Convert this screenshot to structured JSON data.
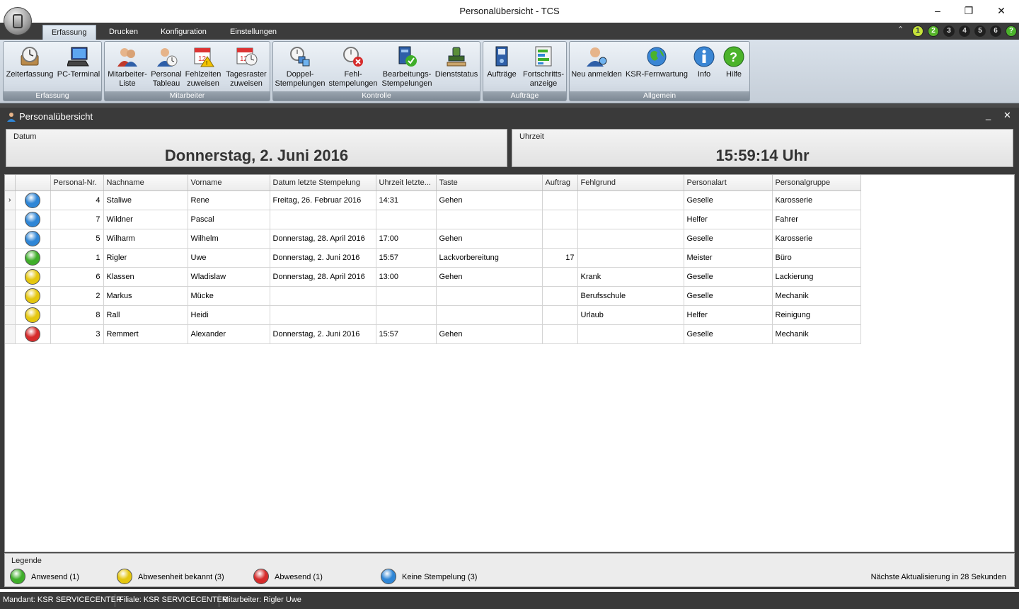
{
  "window": {
    "title": "Personalübersicht - TCS",
    "minimize": "–",
    "maximize": "❐",
    "close": "✕"
  },
  "ribbon_tabs": [
    "Erfassung",
    "Drucken",
    "Konfiguration",
    "Einstellungen"
  ],
  "quick_numbers": [
    "1",
    "2",
    "3",
    "4",
    "5",
    "6",
    "?"
  ],
  "ribbon_groups": [
    {
      "label": "Erfassung",
      "buttons": [
        [
          "Zeiterfassung",
          ""
        ],
        [
          "PC-Terminal",
          ""
        ]
      ]
    },
    {
      "label": "Mitarbeiter",
      "buttons": [
        [
          "Mitarbeiter-",
          "Liste"
        ],
        [
          "Personal",
          "Tableau"
        ],
        [
          "Fehlzeiten",
          "zuweisen"
        ],
        [
          "Tagesraster",
          "zuweisen"
        ]
      ]
    },
    {
      "label": "Kontrolle",
      "buttons": [
        [
          "Doppel-",
          "Stempelungen"
        ],
        [
          "Fehl-",
          "stempelungen"
        ],
        [
          "Bearbeitungs-",
          "Stempelungen"
        ],
        [
          "Dienststatus",
          ""
        ]
      ]
    },
    {
      "label": "Aufträge",
      "buttons": [
        [
          "Aufträge",
          ""
        ],
        [
          "Fortschritts-",
          "anzeige"
        ]
      ]
    },
    {
      "label": "Allgemein",
      "buttons": [
        [
          "Neu anmelden",
          ""
        ],
        [
          "KSR-Fernwartung",
          ""
        ],
        [
          "Info",
          ""
        ],
        [
          "Hilfe",
          ""
        ]
      ]
    }
  ],
  "panel": {
    "title": "Personalübersicht",
    "minimize": "_",
    "close": "✕"
  },
  "datum": {
    "label": "Datum",
    "value": "Donnerstag, 2. Juni 2016"
  },
  "uhrzeit": {
    "label": "Uhrzeit",
    "value": "15:59:14 Uhr"
  },
  "table": {
    "columns": [
      "Personal-Nr.",
      "Nachname",
      "Vorname",
      "Datum letzte Stempelung",
      "Uhrzeit letzte...",
      "Taste",
      "Auftrag",
      "Fehlgrund",
      "Personalart",
      "Personalgruppe"
    ],
    "rows": [
      {
        "status": "blue",
        "nr": "4",
        "nachname": "Staliwe",
        "vorname": "Rene",
        "datum": "Freitag, 26. Februar 2016",
        "uhrzeit": "14:31",
        "taste": "Gehen",
        "auftrag": "",
        "fehlgrund": "",
        "personalart": "Geselle",
        "gruppe": "Karosserie"
      },
      {
        "status": "blue",
        "nr": "7",
        "nachname": "Wildner",
        "vorname": "Pascal",
        "datum": "",
        "uhrzeit": "",
        "taste": "",
        "auftrag": "",
        "fehlgrund": "",
        "personalart": "Helfer",
        "gruppe": "Fahrer"
      },
      {
        "status": "blue",
        "nr": "5",
        "nachname": "Wilharm",
        "vorname": "Wilhelm",
        "datum": "Donnerstag, 28. April 2016",
        "uhrzeit": "17:00",
        "taste": "Gehen",
        "auftrag": "",
        "fehlgrund": "",
        "personalart": "Geselle",
        "gruppe": "Karosserie"
      },
      {
        "status": "green",
        "nr": "1",
        "nachname": "Rigler",
        "vorname": "Uwe",
        "datum": "Donnerstag, 2. Juni 2016",
        "uhrzeit": "15:57",
        "taste": "Lackvorbereitung",
        "auftrag": "17",
        "fehlgrund": "",
        "personalart": "Meister",
        "gruppe": "Büro"
      },
      {
        "status": "yellow",
        "nr": "6",
        "nachname": "Klassen",
        "vorname": "Wladislaw",
        "datum": "Donnerstag, 28. April 2016",
        "uhrzeit": "13:00",
        "taste": "Gehen",
        "auftrag": "",
        "fehlgrund": "Krank",
        "personalart": "Geselle",
        "gruppe": "Lackierung"
      },
      {
        "status": "yellow",
        "nr": "2",
        "nachname": "Markus",
        "vorname": "Mücke",
        "datum": "",
        "uhrzeit": "",
        "taste": "",
        "auftrag": "",
        "fehlgrund": "Berufsschule",
        "personalart": "Geselle",
        "gruppe": "Mechanik"
      },
      {
        "status": "yellow",
        "nr": "8",
        "nachname": "Rall",
        "vorname": "Heidi",
        "datum": "",
        "uhrzeit": "",
        "taste": "",
        "auftrag": "",
        "fehlgrund": "Urlaub",
        "personalart": "Helfer",
        "gruppe": "Reinigung"
      },
      {
        "status": "red",
        "nr": "3",
        "nachname": "Remmert",
        "vorname": "Alexander",
        "datum": "Donnerstag, 2. Juni 2016",
        "uhrzeit": "15:57",
        "taste": "Gehen",
        "auftrag": "",
        "fehlgrund": "",
        "personalart": "Geselle",
        "gruppe": "Mechanik"
      }
    ]
  },
  "legend": {
    "title": "Legende",
    "items": [
      {
        "color": "green",
        "label": "Anwesend (1)"
      },
      {
        "color": "yellow",
        "label": "Abwesenheit bekannt (3)"
      },
      {
        "color": "red",
        "label": "Abwesend (1)"
      },
      {
        "color": "blue",
        "label": "Keine Stempelung (3)"
      }
    ],
    "next_update": "Nächste Aktualisierung in 28 Sekunden"
  },
  "status_colors": {
    "green": "#3fae2a",
    "yellow": "#e5c70f",
    "red": "#d62b2b",
    "blue": "#2f86d6"
  },
  "statusbar": {
    "mandant": "Mandant: KSR SERVICECENTER",
    "filiale": "Filiale: KSR SERVICECENTER",
    "mitarbeiter": "Mitarbeiter: Rigler Uwe"
  }
}
